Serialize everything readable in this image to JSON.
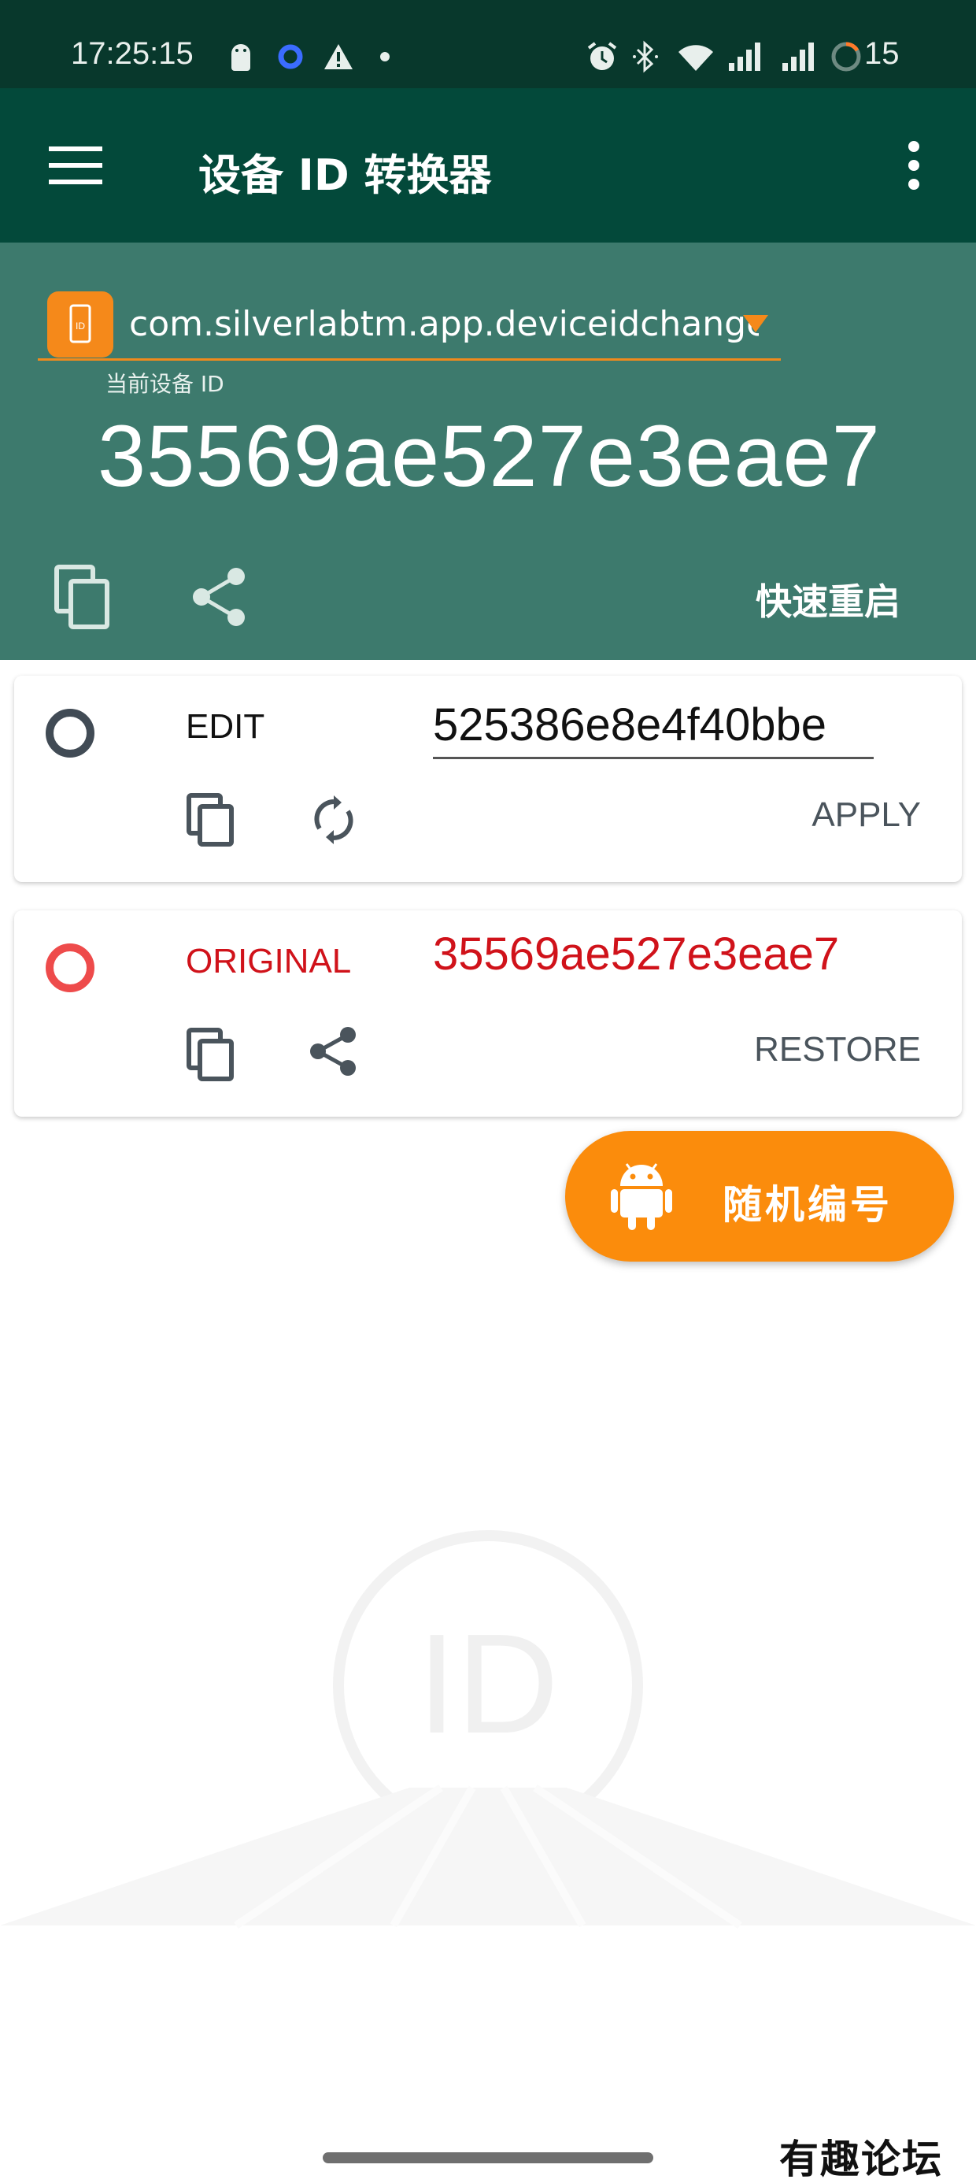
{
  "status_bar": {
    "time": "17:25:15",
    "battery_level": "15",
    "icons_left": [
      "android-debug-icon",
      "vpn-ring-icon",
      "warning-icon",
      "dot-icon"
    ],
    "icons_right": [
      "alarm-icon",
      "bluetooth-icon",
      "wifi-icon",
      "signal-icon",
      "signal-icon",
      "battery-ring-icon"
    ]
  },
  "app_bar": {
    "title": "设备 ID 转换器",
    "menu_icon": "hamburger-menu-icon",
    "overflow_icon": "more-vert-icon"
  },
  "header": {
    "package_name": "com.silverlabtm.app.deviceidchange..",
    "current_id_label": "当前设备 ID",
    "current_id": "35569ae527e3eae7",
    "reboot_label": "快速重启"
  },
  "edit_card": {
    "label": "EDIT",
    "value": "525386e8e4f40bbe",
    "action_label": "APPLY"
  },
  "original_card": {
    "label": "ORIGINAL",
    "value": "35569ae527e3eae7",
    "action_label": "RESTORE"
  },
  "fab": {
    "label": "随机编号",
    "icon": "android-icon"
  },
  "watermark": {
    "text": "ID"
  },
  "site_mark": "有趣论坛",
  "colors": {
    "status_bar": "#08382c",
    "app_bar": "#03493a",
    "header": "#3d7a6d",
    "accent": "#fb8c0c",
    "original_red": "#d0121a"
  }
}
